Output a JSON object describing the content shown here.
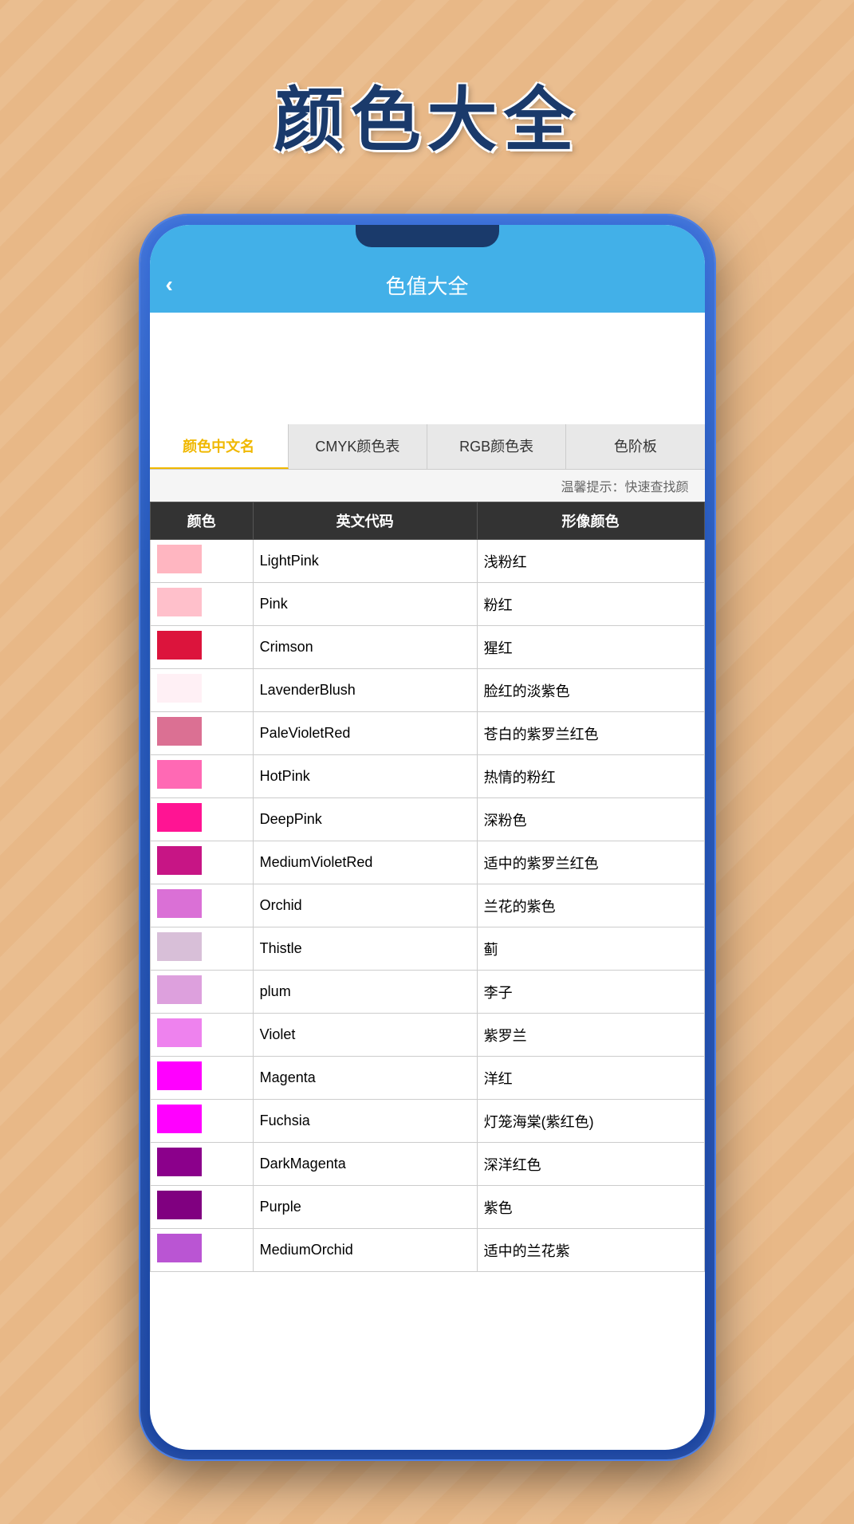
{
  "page": {
    "title": "颜色大全",
    "background_color": "#E8B887"
  },
  "app": {
    "header_title": "色值大全",
    "back_label": "‹",
    "hint_text": "温馨提示：快速查找颜"
  },
  "tabs": [
    {
      "label": "颜色中文名",
      "active": true
    },
    {
      "label": "CMYK颜色表",
      "active": false
    },
    {
      "label": "RGB颜色表",
      "active": false
    },
    {
      "label": "色阶板",
      "active": false
    }
  ],
  "table": {
    "headers": [
      "颜色",
      "英文代码",
      "形像颜色"
    ],
    "rows": [
      {
        "color": "#FFB6C1",
        "name": "LightPink",
        "zh": "浅粉红"
      },
      {
        "color": "#FFC0CB",
        "name": "Pink",
        "zh": "粉红"
      },
      {
        "color": "#DC143C",
        "name": "Crimson",
        "zh": "猩红"
      },
      {
        "color": "#FFF0F5",
        "name": "LavenderBlush",
        "zh": "脸红的淡紫色"
      },
      {
        "color": "#DB7093",
        "name": "PaleVioletRed",
        "zh": "苍白的紫罗兰红色"
      },
      {
        "color": "#FF69B4",
        "name": "HotPink",
        "zh": "热情的粉红"
      },
      {
        "color": "#FF1493",
        "name": "DeepPink",
        "zh": "深粉色"
      },
      {
        "color": "#C71585",
        "name": "MediumVioletRed",
        "zh": "适中的紫罗兰红色"
      },
      {
        "color": "#DA70D6",
        "name": "Orchid",
        "zh": "兰花的紫色"
      },
      {
        "color": "#D8BFD8",
        "name": "Thistle",
        "zh": "蓟"
      },
      {
        "color": "#DDA0DD",
        "name": "plum",
        "zh": "李子"
      },
      {
        "color": "#EE82EE",
        "name": "Violet",
        "zh": "紫罗兰"
      },
      {
        "color": "#FF00FF",
        "name": "Magenta",
        "zh": "洋红"
      },
      {
        "color": "#FF00FF",
        "name": "Fuchsia",
        "zh": "灯笼海棠(紫红色)"
      },
      {
        "color": "#8B008B",
        "name": "DarkMagenta",
        "zh": "深洋红色"
      },
      {
        "color": "#800080",
        "name": "Purple",
        "zh": "紫色"
      },
      {
        "color": "#BA55D3",
        "name": "MediumOrchid",
        "zh": "适中的兰花紫"
      }
    ]
  }
}
